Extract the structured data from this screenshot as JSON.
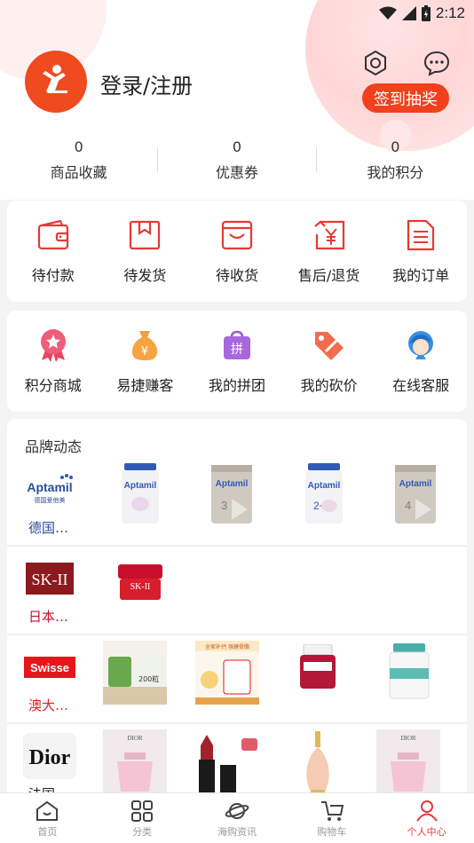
{
  "status": {
    "time": "2:12"
  },
  "profile": {
    "login_text": "登录/注册",
    "signin_label": "签到抽奖"
  },
  "stats": [
    {
      "value": "0",
      "label": "商品收藏"
    },
    {
      "value": "0",
      "label": "优惠券"
    },
    {
      "value": "0",
      "label": "我的积分"
    }
  ],
  "orders": [
    {
      "label": "待付款",
      "icon": "wallet-icon"
    },
    {
      "label": "待发货",
      "icon": "box-icon"
    },
    {
      "label": "待收货",
      "icon": "receive-box-icon"
    },
    {
      "label": "售后/退货",
      "icon": "refund-icon"
    },
    {
      "label": "我的订单",
      "icon": "order-list-icon"
    }
  ],
  "services": [
    {
      "label": "积分商城",
      "icon": "points-mall-icon"
    },
    {
      "label": "易捷赚客",
      "icon": "money-bag-icon"
    },
    {
      "label": "我的拼团",
      "icon": "group-buy-icon"
    },
    {
      "label": "我的砍价",
      "icon": "bargain-tag-icon"
    },
    {
      "label": "在线客服",
      "icon": "customer-service-icon"
    }
  ],
  "brands": {
    "title": "品牌动态",
    "rows": [
      {
        "logo": "Aptamil",
        "logo_sub": "德国爱他美",
        "country": "德国…",
        "country_color": "#2b4a9a",
        "products": [
          "Aptamil",
          "Aptamil",
          "Aptamil",
          "Aptamil"
        ]
      },
      {
        "logo": "SK-II",
        "country": "日本…",
        "country_color": "#c8102e",
        "products": [
          "SK-II"
        ]
      },
      {
        "logo": "Swisse",
        "country": "澳大…",
        "country_color": "#e02020",
        "products": [
          "200粒",
          "全家补钙 强健骨骼",
          "",
          ""
        ]
      },
      {
        "logo": "Dior",
        "country": "法国…",
        "country_color": "#222222",
        "products": [
          "DIOR",
          "",
          "",
          "DIOR"
        ]
      }
    ]
  },
  "tabs": [
    {
      "label": "首页",
      "icon": "home-icon"
    },
    {
      "label": "分类",
      "icon": "category-icon"
    },
    {
      "label": "海购资讯",
      "icon": "planet-icon"
    },
    {
      "label": "购物车",
      "icon": "cart-icon"
    },
    {
      "label": "个人中心",
      "icon": "user-icon",
      "active": true
    }
  ],
  "colors": {
    "accent": "#f0401c",
    "tab_active": "#e8383d"
  }
}
